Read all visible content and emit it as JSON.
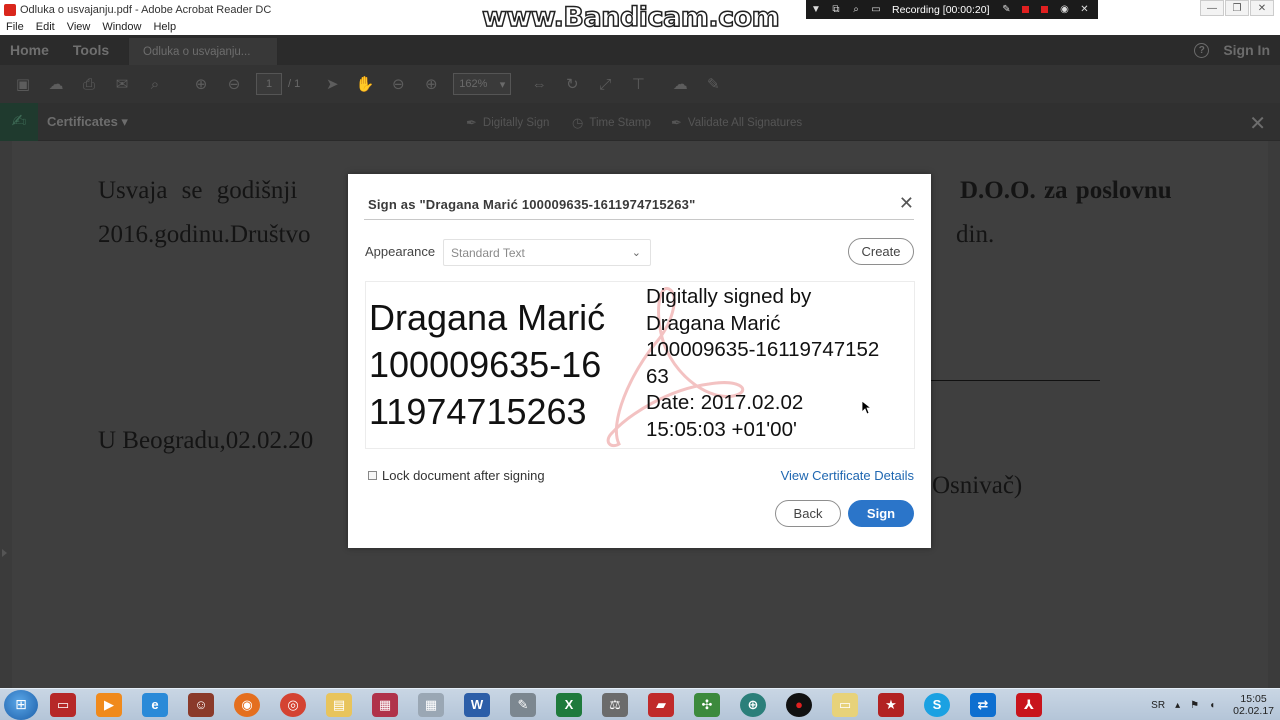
{
  "window": {
    "title": "Odluka o usvajanju.pdf - Adobe Acrobat Reader DC",
    "menu": [
      "File",
      "Edit",
      "View",
      "Window",
      "Help"
    ],
    "controls": [
      "—",
      "❐",
      "✕"
    ]
  },
  "overlay": {
    "bandicam_text": "www.Bandicam.com",
    "recording_label": "Recording [00:00:20]"
  },
  "app": {
    "tabs": [
      "Home",
      "Tools"
    ],
    "document_tab": "Odluka o usvajanju...",
    "sign_in": "Sign In",
    "toolbar": {
      "page_current": "1",
      "page_total": "/ 1",
      "zoom": "162%"
    },
    "certificates": {
      "label": "Certificates ▾",
      "tools": [
        "Digitally Sign",
        "Time Stamp",
        "Validate All Signatures"
      ]
    }
  },
  "document": {
    "line1_left": "Usvaja   se   godišnji",
    "line1_right": "D.O.O.    za    poslovnu",
    "line2_left": "2016.godinu.Društvo",
    "line2_right": "din.",
    "city_date": "U Beogradu,02.02.20",
    "signer_role": "Osnivač)"
  },
  "dialog": {
    "title": "Sign as \"Dragana Marić 100009635-1611974715263\"",
    "appearance_label": "Appearance",
    "appearance_value": "Standard Text",
    "create_label": "Create",
    "preview": {
      "name_lines": [
        "Dragana Marić",
        "100009635-16",
        "11974715263"
      ],
      "detail_lines": [
        "Digitally signed by",
        "Dragana Marić",
        "100009635-16119747152",
        "63",
        "Date: 2017.02.02",
        "15:05:03 +01'00'"
      ]
    },
    "lock_label": "Lock document after signing",
    "view_cert_label": "View Certificate Details",
    "back_label": "Back",
    "sign_label": "Sign"
  },
  "taskbar": {
    "language": "SR",
    "time": "15:05",
    "date": "02.02.17",
    "apps": [
      "media-center",
      "media-player",
      "internet-explorer",
      "user-app",
      "firefox",
      "chrome",
      "file-explorer",
      "winrar",
      "calculator",
      "word",
      "notepad-tool",
      "excel",
      "scales-app",
      "red-app",
      "network-app",
      "globe-app",
      "record-app",
      "folder-app",
      "game-app",
      "skype",
      "teamviewer",
      "acrobat"
    ]
  },
  "colors": {
    "sign_button": "#2b75c9",
    "link": "#1f67b1",
    "dim_overlay": "#3a3a3a"
  }
}
